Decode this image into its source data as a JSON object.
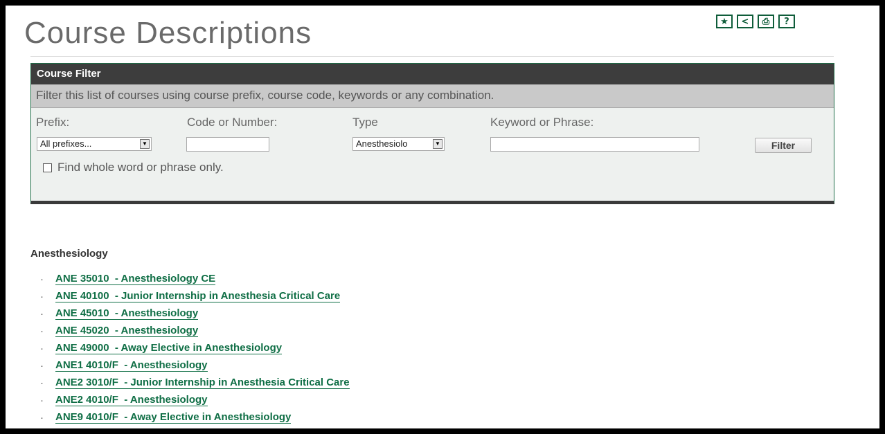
{
  "page": {
    "title": "Course Descriptions"
  },
  "toolbar": {
    "favorite_icon": "★",
    "share_icon": "<",
    "print_icon": "⎙",
    "help_icon": "?"
  },
  "filter": {
    "header": "Course Filter",
    "description": "Filter this list of courses using course prefix, course code, keywords or any combination.",
    "prefix_label": "Prefix:",
    "prefix_value": "All prefixes...",
    "code_label": "Code or Number:",
    "code_value": "",
    "type_label": "Type",
    "type_value": "Anesthesiolo",
    "keyword_label": "Keyword or Phrase:",
    "keyword_value": "",
    "filter_button": "Filter",
    "whole_word_label": "Find whole word or phrase only."
  },
  "section": {
    "title": "Anesthesiology",
    "courses": [
      "ANE 35010  - Anesthesiology CE",
      "ANE 40100  - Junior Internship in Anesthesia Critical Care",
      "ANE 45010  - Anesthesiology",
      "ANE 45020  - Anesthesiology",
      "ANE 49000  - Away Elective in Anesthesiology",
      "ANE1 4010/F  - Anesthesiology",
      "ANE2 3010/F  - Junior Internship in Anesthesia Critical Care",
      "ANE2 4010/F  - Anesthesiology",
      "ANE9 4010/F  - Away Elective in Anesthesiology"
    ]
  },
  "colors": {
    "accent": "#0f6e45",
    "header_bg": "#3d3d3d"
  }
}
